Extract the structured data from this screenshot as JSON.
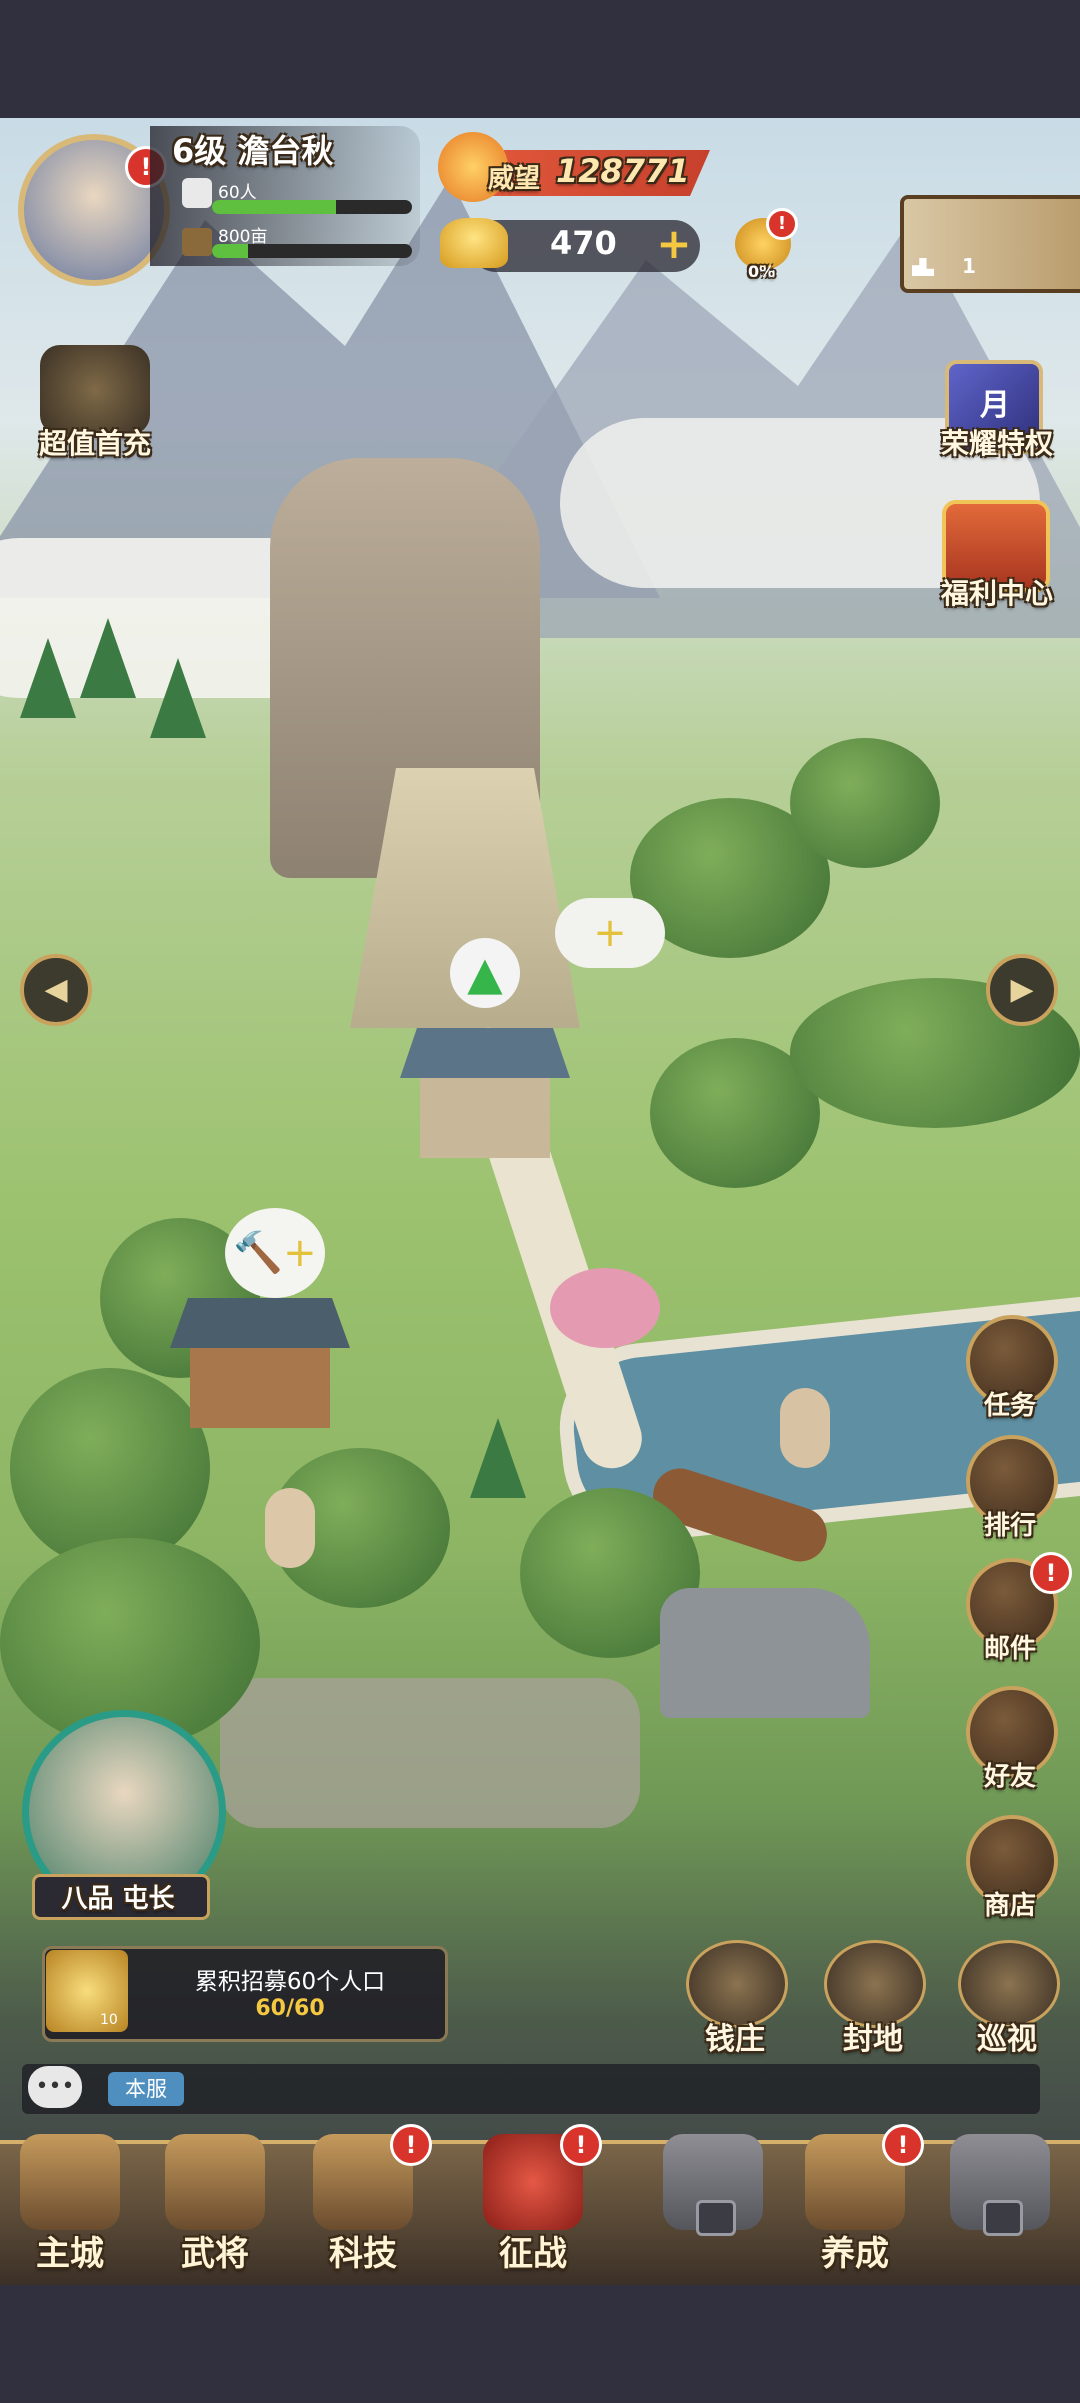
{
  "player": {
    "level_name": "6级 澹台秋",
    "population": "60人",
    "land": "800亩",
    "prestige_label": "威望",
    "prestige_value": "128771",
    "gold": "470",
    "gold_add": "+",
    "bonus_percent": "0%",
    "rank_number": "1"
  },
  "left_menu": {
    "first_recharge": "超值首充"
  },
  "right_menu": {
    "honor_privilege": "荣耀特权",
    "honor_badge": "月",
    "welfare_center": "福利中心"
  },
  "side_buttons": [
    {
      "label": "任务",
      "icon": "scroll-icon",
      "badge": false
    },
    {
      "label": "排行",
      "icon": "podium-icon",
      "badge": false
    },
    {
      "label": "邮件",
      "icon": "mail-icon",
      "badge": true
    },
    {
      "label": "好友",
      "icon": "friend-icon",
      "badge": false
    },
    {
      "label": "商店",
      "icon": "shop-icon",
      "badge": false
    }
  ],
  "feature_buttons": [
    {
      "label": "钱庄",
      "icon": "abacus-icon"
    },
    {
      "label": "封地",
      "icon": "fief-icon"
    },
    {
      "label": "巡视",
      "icon": "horse-icon"
    }
  ],
  "hero": {
    "rank_title": "八品 屯长"
  },
  "quest": {
    "text": "累积招募60个人口",
    "progress": "60/60",
    "progress_fraction": 1.0,
    "reward_count": "10"
  },
  "chat": {
    "channel": "本服",
    "icon": "chat-bubble-icon"
  },
  "badge_symbol": "!",
  "bottom_nav": [
    {
      "label": "主城",
      "icon": "city-icon",
      "badge": false,
      "locked": false
    },
    {
      "label": "武将",
      "icon": "general-icon",
      "badge": false,
      "locked": false
    },
    {
      "label": "科技",
      "icon": "tech-scroll-icon",
      "badge": true,
      "locked": false
    },
    {
      "label": "征战",
      "icon": "battle-icon",
      "badge": true,
      "locked": false
    },
    {
      "label": "",
      "icon": "locked-shield-icon",
      "badge": false,
      "locked": true
    },
    {
      "label": "养成",
      "icon": "sword-icon",
      "badge": true,
      "locked": false
    },
    {
      "label": "",
      "icon": "locked-anvil-icon",
      "badge": false,
      "locked": true
    }
  ],
  "colors": {
    "frame": "#30303f",
    "gold_text": "#fff4d6",
    "badge_red": "#d9342b",
    "progress_green": "#5fbf3f",
    "quest_accent": "#f5c842"
  }
}
